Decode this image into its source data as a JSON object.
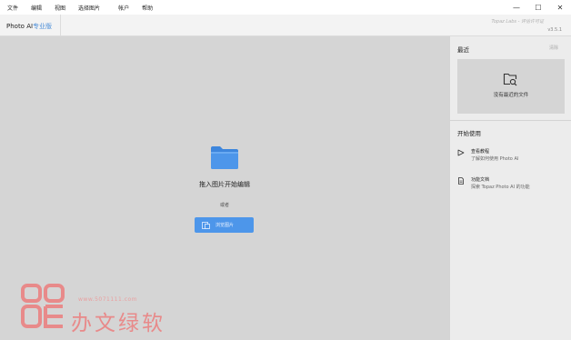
{
  "menubar": {
    "items": [
      "文件",
      "编辑",
      "视图",
      "选择图片",
      "帐户",
      "帮助"
    ]
  },
  "window_controls": {
    "minimize": "—",
    "maximize": "☐",
    "close": "✕"
  },
  "header": {
    "app_name": "Photo AI",
    "edition": "专业版",
    "brand": "Topaz Labs - 评估许可证",
    "version": "v3.5.1"
  },
  "main": {
    "drop_text": "拖入图片开始编辑",
    "or_text": "或者",
    "browse_label": "浏览图片"
  },
  "recent": {
    "title": "最近",
    "clear": "清除",
    "empty_text": "没有最近的文件"
  },
  "getting_started": {
    "title": "开始使用",
    "items": [
      {
        "title": "查看教程",
        "subtitle": "了解如何使用 Photo AI"
      },
      {
        "title": "功能文档",
        "subtitle": "探索 Topaz Photo AI 的功能"
      }
    ]
  },
  "watermark": {
    "url": "www.5071111.com",
    "text": "办文绿软"
  },
  "colors": {
    "accent": "#4d96ea",
    "drop_area": "#d5d5d5",
    "panel": "#ececec",
    "watermark": "#e88a8a"
  }
}
